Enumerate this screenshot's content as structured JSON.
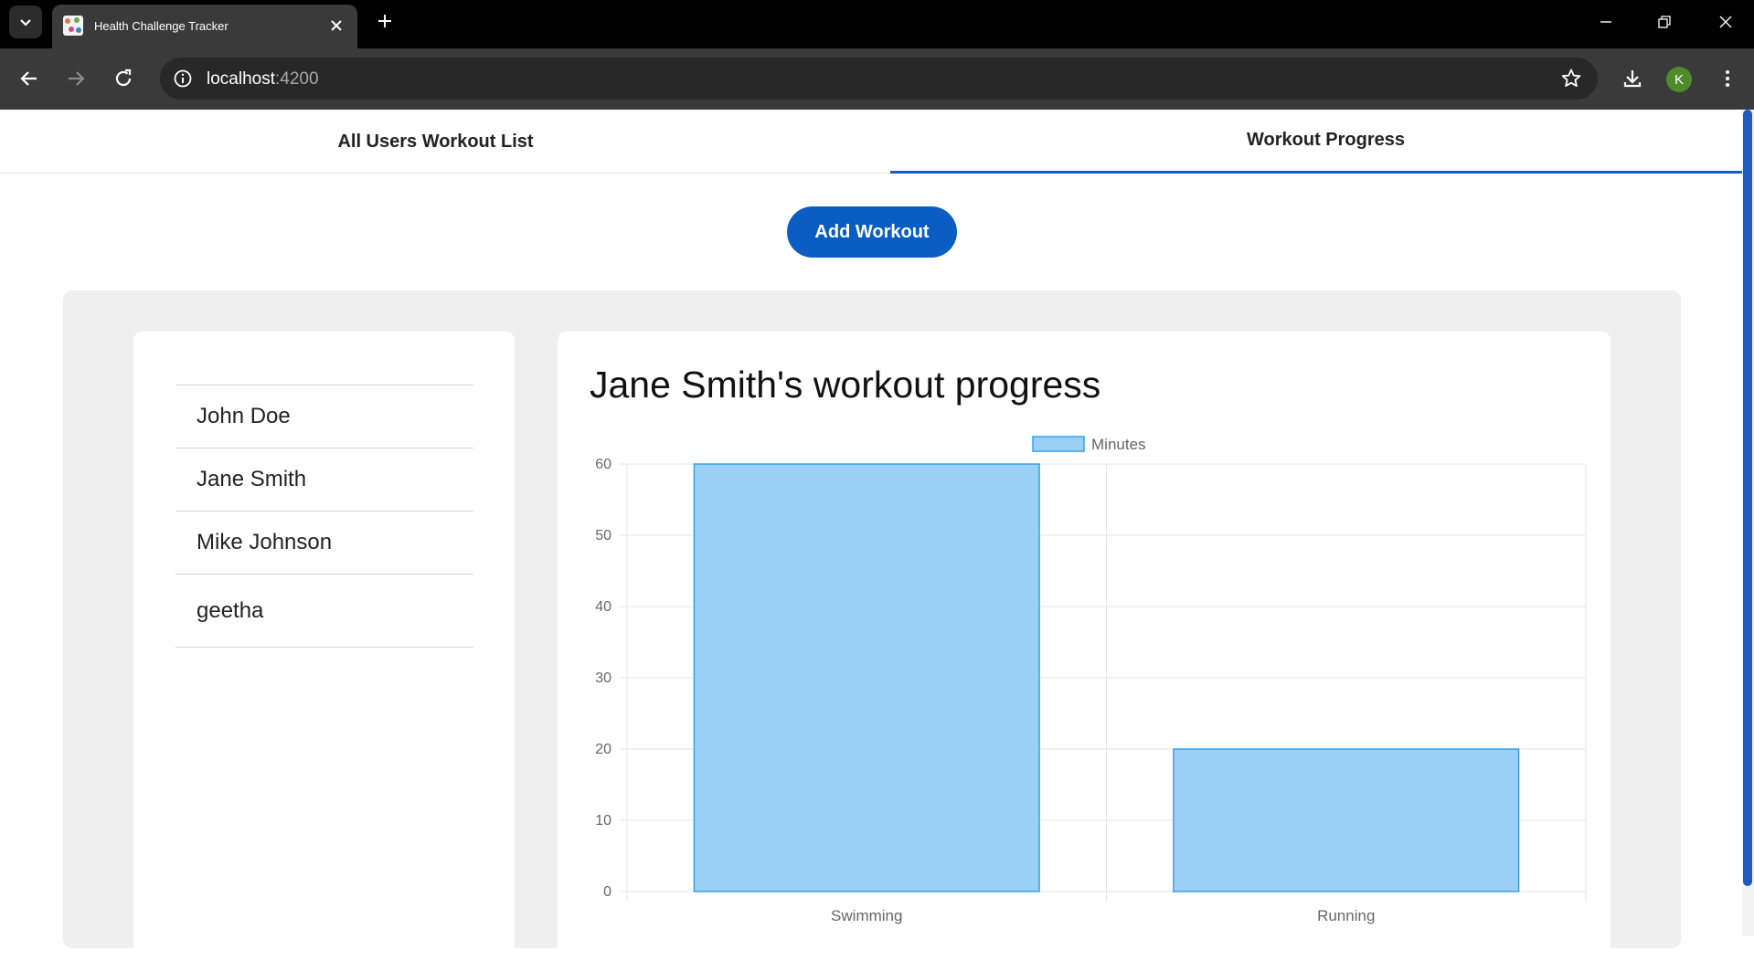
{
  "browser": {
    "tab_title": "Health Challenge Tracker",
    "url_host": "localhost",
    "url_port": ":4200",
    "profile_initial": "K"
  },
  "app": {
    "tabs": [
      {
        "label": "All Users Workout List",
        "active": false
      },
      {
        "label": "Workout Progress",
        "active": true
      }
    ],
    "add_workout_label": "Add Workout",
    "users": [
      "John Doe",
      "Jane Smith",
      "Mike Johnson",
      "geetha"
    ],
    "chart_title": "Jane Smith's workout progress"
  },
  "colors": {
    "accent": "#0a5dc2",
    "bar_fill": "#9ad0f5",
    "bar_border": "#36a2eb"
  },
  "chart_data": {
    "type": "bar",
    "categories": [
      "Swimming",
      "Running"
    ],
    "series": [
      {
        "name": "Minutes",
        "values": [
          60,
          20
        ]
      }
    ],
    "ylim": [
      0,
      60
    ],
    "yticks": [
      0,
      10,
      20,
      30,
      40,
      50,
      60
    ],
    "legend": "top",
    "grid": true
  }
}
